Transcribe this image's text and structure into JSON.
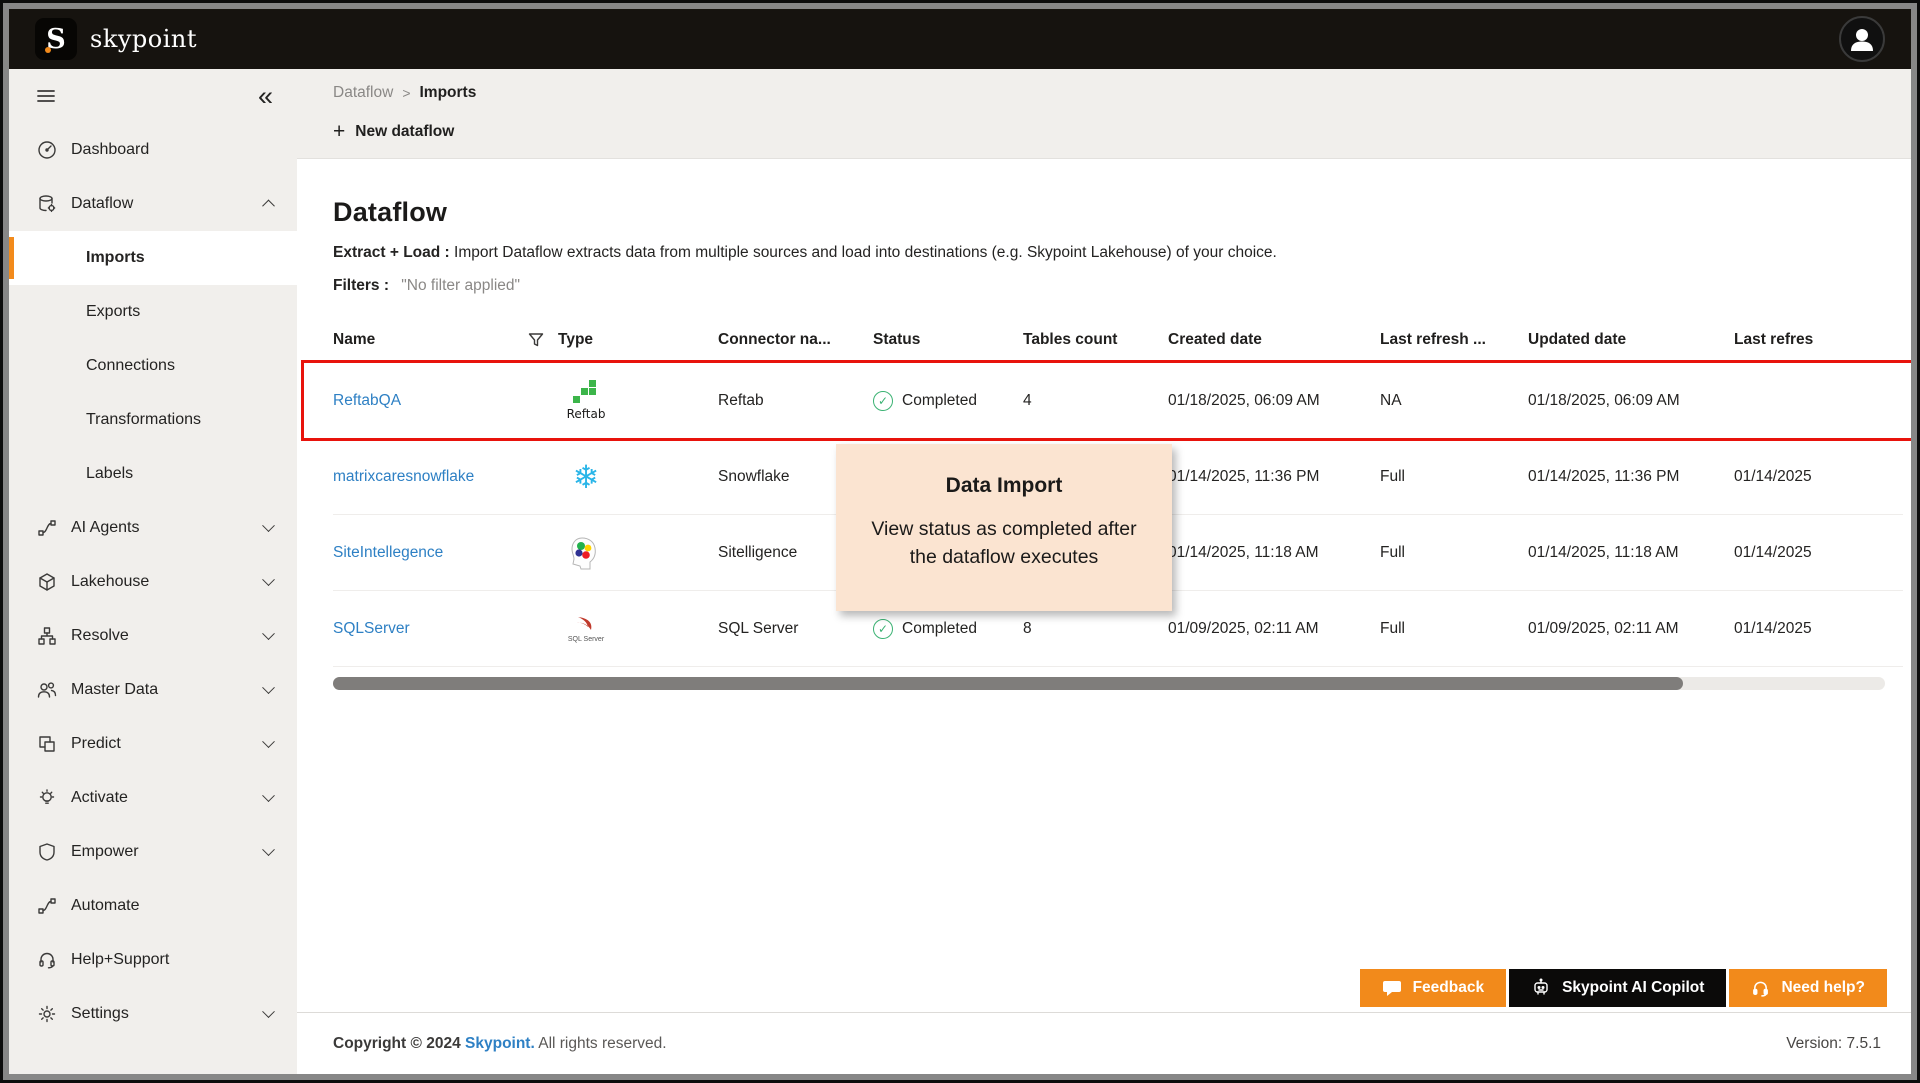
{
  "topbar": {
    "logo_letter": "S",
    "brand": "skypoint"
  },
  "sidebar": {
    "items": [
      {
        "label": "Dashboard"
      },
      {
        "label": "Dataflow"
      },
      {
        "label": "Imports"
      },
      {
        "label": "Exports"
      },
      {
        "label": "Connections"
      },
      {
        "label": "Transformations"
      },
      {
        "label": "Labels"
      },
      {
        "label": "AI Agents"
      },
      {
        "label": "Lakehouse"
      },
      {
        "label": "Resolve"
      },
      {
        "label": "Master Data"
      },
      {
        "label": "Predict"
      },
      {
        "label": "Activate"
      },
      {
        "label": "Empower"
      },
      {
        "label": "Automate"
      },
      {
        "label": "Help+Support"
      },
      {
        "label": "Settings"
      }
    ]
  },
  "breadcrumb": {
    "parent": "Dataflow",
    "separator": ">",
    "current": "Imports"
  },
  "toolbar": {
    "plus": "+",
    "new_dataflow_label": "New dataflow"
  },
  "page": {
    "title": "Dataflow",
    "description_bold": "Extract + Load :",
    "description_rest": " Import Dataflow extracts data from multiple sources and load into destinations (e.g. Skypoint Lakehouse) of your choice.",
    "filters_label": "Filters :",
    "filters_value": "\"No filter applied\""
  },
  "table": {
    "columns": [
      "Name",
      "Type",
      "Connector na...",
      "Status",
      "Tables count",
      "Created date",
      "Last refresh ...",
      "Updated date",
      "Last refres"
    ],
    "rows": [
      {
        "name": "ReftabQA",
        "logo": "reftab-logo",
        "logo_text": "Reftab",
        "connector": "Reftab",
        "status": "Completed",
        "tables_count": "4",
        "created_date": "01/18/2025, 06:09 AM",
        "last_refresh_type": "NA",
        "updated_date": "01/18/2025, 06:09 AM",
        "last_refresh_date": ""
      },
      {
        "name": "matrixcaresnowflake",
        "logo": "snowflake-logo",
        "connector": "Snowflake",
        "status": "",
        "tables_count": "",
        "created_date": "01/14/2025, 11:36 PM",
        "last_refresh_type": "Full",
        "updated_date": "01/14/2025, 11:36 PM",
        "last_refresh_date": "01/14/2025"
      },
      {
        "name": "SiteIntellegence",
        "logo": "sitelligence-logo",
        "connector": "Sitelligence",
        "status": "",
        "tables_count": "",
        "created_date": "01/14/2025, 11:18 AM",
        "last_refresh_type": "Full",
        "updated_date": "01/14/2025, 11:18 AM",
        "last_refresh_date": "01/14/2025"
      },
      {
        "name": "SQLServer",
        "logo": "sqlserver-logo",
        "logo_text": "SQL Server",
        "connector": "SQL Server",
        "status": "Completed",
        "tables_count": "8",
        "created_date": "01/09/2025, 02:11 AM",
        "last_refresh_type": "Full",
        "updated_date": "01/09/2025, 02:11 AM",
        "last_refresh_date": "01/14/2025"
      }
    ],
    "status_check_color": "#3bb273",
    "highlight_color": "#e8130c"
  },
  "tooltip": {
    "title": "Data Import",
    "body": "View status as completed after the dataflow executes",
    "background": "#fbe4d1"
  },
  "float_buttons": {
    "feedback": "Feedback",
    "copilot": "Skypoint AI Copilot",
    "need_help": "Need help?",
    "orange": "#f28a1b",
    "black": "#0b0a09"
  },
  "footer": {
    "copyright_prefix": "Copyright © 2024 ",
    "brand_link": "Skypoint.",
    "copyright_suffix": " All rights reserved.",
    "version": "Version: 7.5.1"
  }
}
